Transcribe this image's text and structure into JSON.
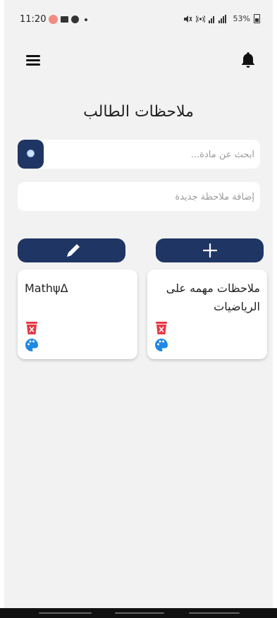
{
  "status_bar": {
    "time": "11:20",
    "battery": "53%",
    "icons": [
      "record-icon",
      "image-icon",
      "facebook-icon",
      "dot-icon",
      "mute-icon",
      "hotspot-icon",
      "signal-icon",
      "battery-icon"
    ]
  },
  "header": {
    "menu_icon": "hamburger-menu-icon",
    "notification_icon": "bell-icon"
  },
  "page": {
    "title": "ملاحظات الطالب"
  },
  "search": {
    "placeholder": "ابحث عن مادة...",
    "value": "",
    "icon": "search-icon"
  },
  "new_note": {
    "placeholder": "إضافة ملاحظة جديدة",
    "value": ""
  },
  "actions": {
    "edit_icon": "pencil-icon",
    "add_icon": "plus-icon"
  },
  "notes": [
    {
      "title": "MathψΔ",
      "icons": [
        "trash-icon",
        "palette-icon"
      ]
    },
    {
      "title": "ملاحظات مهمه على الرياضيات",
      "icons": [
        "trash-icon",
        "palette-icon"
      ]
    }
  ],
  "colors": {
    "primary": "#1f3564",
    "background": "#f2f2f2",
    "card": "#ffffff",
    "trash": "#e53945",
    "palette": "#1e88e5"
  }
}
